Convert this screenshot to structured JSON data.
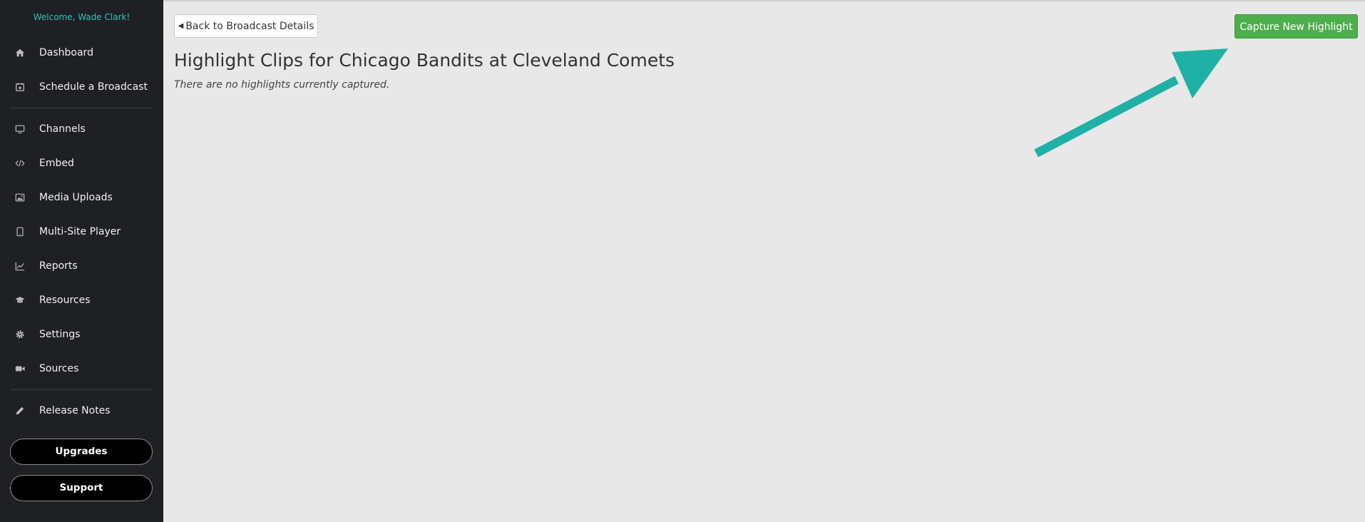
{
  "sidebar": {
    "welcome": "Welcome, Wade Clark!",
    "items": [
      {
        "label": "Dashboard",
        "icon": "home-icon"
      },
      {
        "label": "Schedule a Broadcast",
        "icon": "calendar-plus-icon"
      },
      {
        "label": "Channels",
        "icon": "monitor-icon"
      },
      {
        "label": "Embed",
        "icon": "code-icon"
      },
      {
        "label": "Media Uploads",
        "icon": "image-icon"
      },
      {
        "label": "Multi-Site Player",
        "icon": "tablet-icon"
      },
      {
        "label": "Reports",
        "icon": "line-chart-icon"
      },
      {
        "label": "Resources",
        "icon": "graduation-cap-icon"
      },
      {
        "label": "Settings",
        "icon": "gear-icon"
      },
      {
        "label": "Sources",
        "icon": "video-camera-icon"
      },
      {
        "label": "Release Notes",
        "icon": "pencil-icon"
      }
    ],
    "upgrades_label": "Upgrades",
    "support_label": "Support"
  },
  "main": {
    "back_label": "Back to Broadcast Details",
    "title": "Highlight Clips for Chicago Bandits at Cleveland Comets",
    "empty_message": "There are no highlights currently captured.",
    "capture_label": "Capture New Highlight"
  },
  "colors": {
    "sidebar_bg": "#1e2024",
    "welcome_text": "#2ec4c4",
    "capture_button": "#4cae4c",
    "annotation_arrow": "#1fb0a6",
    "page_bg": "#e8e8e8"
  }
}
